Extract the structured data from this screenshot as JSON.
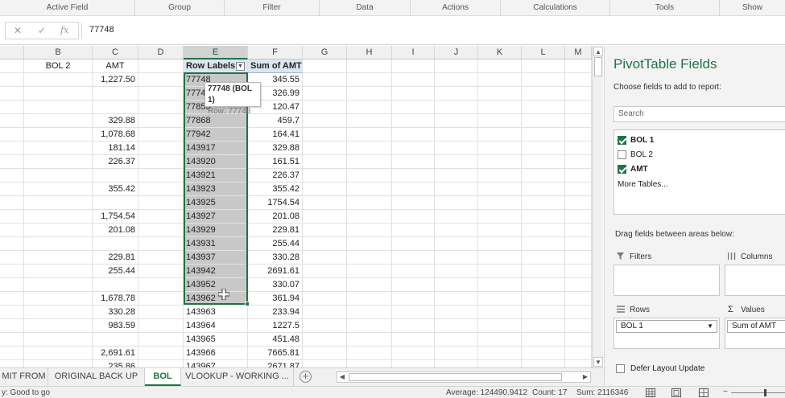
{
  "ribbon": {
    "groups": [
      "Active Field",
      "Group",
      "Filter",
      "Data",
      "Actions",
      "Calculations",
      "Tools",
      "Show"
    ]
  },
  "formula_bar": {
    "cancel_icon": "✕",
    "enter_icon": "✓",
    "fx_label": "fx",
    "value": "77748"
  },
  "columns": [
    "B",
    "C",
    "D",
    "E",
    "F",
    "G",
    "H",
    "I",
    "J",
    "K",
    "L",
    "M"
  ],
  "header_row": {
    "b": "BOL 2",
    "c": "AMT",
    "e": "Row Labels",
    "f": "Sum of AMT"
  },
  "rows": [
    {
      "c": "1,227.50",
      "e": "77748",
      "f": "345.55"
    },
    {
      "c": "",
      "e": "77748",
      "f": "326.99"
    },
    {
      "c": "",
      "e": "77853",
      "f": "120.47"
    },
    {
      "c": "329.88",
      "e": "77868",
      "f": "459.7"
    },
    {
      "c": "1,078.68",
      "e": "77942",
      "f": "164.41"
    },
    {
      "c": "181.14",
      "e": "143917",
      "f": "329.88"
    },
    {
      "c": "226.37",
      "e": "143920",
      "f": "161.51"
    },
    {
      "c": "",
      "e": "143921",
      "f": "226.37"
    },
    {
      "c": "355.42",
      "e": "143923",
      "f": "355.42"
    },
    {
      "c": "",
      "e": "143925",
      "f": "1754.54"
    },
    {
      "c": "1,754.54",
      "e": "143927",
      "f": "201.08"
    },
    {
      "c": "201.08",
      "e": "143929",
      "f": "229.81"
    },
    {
      "c": "",
      "e": "143931",
      "f": "255.44"
    },
    {
      "c": "229.81",
      "e": "143937",
      "f": "330.28"
    },
    {
      "c": "255.44",
      "e": "143942",
      "f": "2691.61"
    },
    {
      "c": "",
      "e": "143952",
      "f": "330.07"
    },
    {
      "c": "1,678.78",
      "e": "143962",
      "f": "361.94"
    },
    {
      "c": "330.28",
      "e": "143963",
      "f": "233.94"
    },
    {
      "c": "983.59",
      "e": "143964",
      "f": "1227.5"
    },
    {
      "c": "",
      "e": "143965",
      "f": "451.48"
    },
    {
      "c": "2,691.61",
      "e": "143966",
      "f": "7665.81"
    },
    {
      "c": "235.86",
      "e": "143967",
      "f": "2671.87"
    }
  ],
  "tooltip": {
    "line1": "77748 (BOL 1)",
    "line2": "Row: 77748"
  },
  "sheet_tabs": [
    "MIT FROM",
    "ORIGINAL BACK UP",
    "BOL",
    "VLOOKUP - WORKING ..."
  ],
  "status_bar": {
    "ready": "y: Good to go",
    "average": "Average: 124490.9412",
    "count": "Count: 17",
    "sum": "Sum: 2116346"
  },
  "pivot_pane": {
    "title": "PivotTable Fields",
    "subtitle": "Choose fields to add to report:",
    "search_placeholder": "Search",
    "fields": [
      {
        "label": "BOL 1",
        "checked": true
      },
      {
        "label": "BOL 2",
        "checked": false
      },
      {
        "label": "AMT",
        "checked": true
      }
    ],
    "more_tables": "More Tables...",
    "drag_hint": "Drag fields between areas below:",
    "areas": {
      "filters": "Filters",
      "columns": "Columns",
      "rows": "Rows",
      "values": "Values"
    },
    "rows_field": "BOL 1",
    "values_field": "Sum of AMT",
    "defer_label": "Defer Layout Update"
  },
  "colors": {
    "accent": "#217346",
    "selection": "#c8c8c8"
  }
}
